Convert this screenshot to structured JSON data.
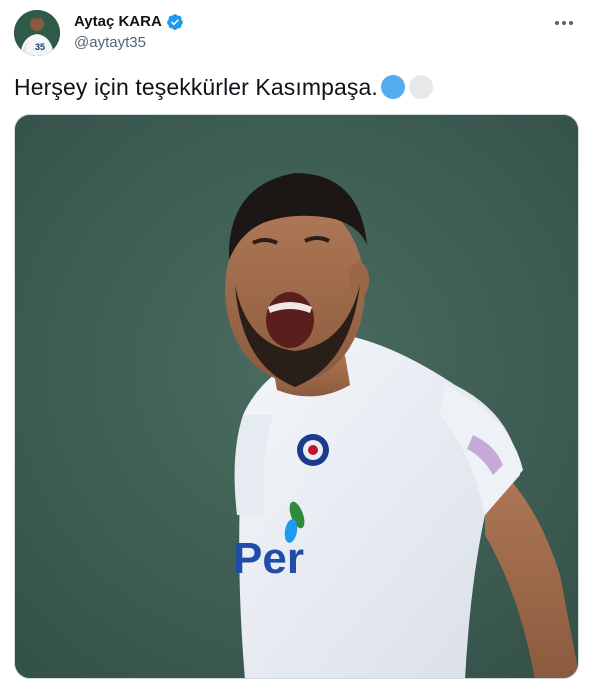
{
  "tweet": {
    "author": {
      "display_name": "Aytaç KARA",
      "handle": "@aytayt35",
      "verified": true,
      "avatar_jersey_number": "35"
    },
    "text": "Herşey için teşekkürler Kasımpaşa.",
    "emojis": [
      "blue-heart",
      "white-heart"
    ],
    "media": {
      "type": "video",
      "jersey_text": "Per"
    }
  },
  "colors": {
    "verified_blue": "#1d9bf0",
    "text_primary": "#0f1419",
    "text_secondary": "#536471",
    "media_background": "#3f5e54"
  },
  "icons": {
    "more": "more-horizontal-icon",
    "verified": "verified-badge-icon"
  }
}
